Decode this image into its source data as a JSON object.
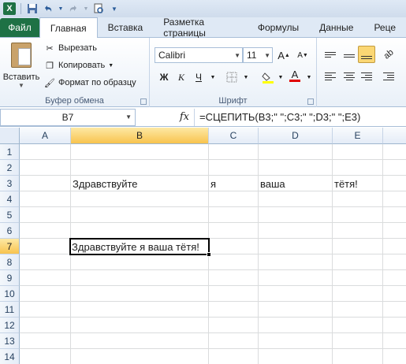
{
  "qat": {
    "app_icon": "excel-icon",
    "items": [
      "save-icon",
      "undo-icon",
      "redo-icon",
      "print-preview-icon",
      "customize-icon"
    ]
  },
  "tabs": [
    {
      "label": "Файл"
    },
    {
      "label": "Главная"
    },
    {
      "label": "Вставка"
    },
    {
      "label": "Разметка страницы"
    },
    {
      "label": "Формулы"
    },
    {
      "label": "Данные"
    },
    {
      "label": "Реце"
    }
  ],
  "clipboard": {
    "paste_label": "Вставить",
    "cut_label": "Вырезать",
    "copy_label": "Копировать",
    "format_painter_label": "Формат по образцу",
    "group_label": "Буфер обмена"
  },
  "font": {
    "name": "Calibri",
    "size": "11",
    "bold": "Ж",
    "italic": "К",
    "underline": "Ч",
    "grow": "A",
    "shrink": "A",
    "font_color_letter": "A",
    "group_label": "Шрифт"
  },
  "formula_bar": {
    "name_box": "B7",
    "fx": "fx",
    "formula": "=СЦЕПИТЬ(B3;\" \";C3;\" \";D3;\" \";E3)"
  },
  "columns": [
    "A",
    "B",
    "C",
    "D",
    "E"
  ],
  "rows": [
    "1",
    "2",
    "3",
    "4",
    "5",
    "6",
    "7",
    "8",
    "9",
    "10",
    "11",
    "12",
    "13",
    "14"
  ],
  "cells": {
    "B3": "Здравствуйте",
    "C3": "я",
    "D3": "ваша",
    "E3": "тётя!",
    "B7": "Здравствуйте я ваша тётя!"
  },
  "colors": {
    "file_tab": "#1e7145",
    "selected_header": "#f8c34e",
    "active_border": "#000000"
  }
}
